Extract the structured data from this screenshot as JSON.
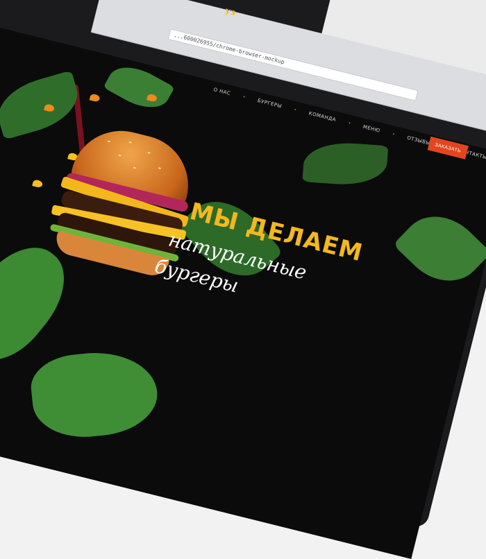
{
  "browser": {
    "url": "...600026955/chrome-browser-mockup",
    "logo_fragment": "уз"
  },
  "nav": {
    "items": [
      "О НАС",
      "БУРГЕРЫ",
      "КОМАНДА",
      "МЕНЮ",
      "ОТЗЫВЫ",
      "КОНТАКТЫ"
    ],
    "separator": "•",
    "order_button": "ЗАКАЗАТЬ"
  },
  "hero": {
    "line1": "МЫ ДЕЛАЕМ",
    "line2": "натуральные",
    "line3": "бургеры"
  },
  "colors": {
    "accent": "#e2461f",
    "headline_yellow": "#f4b81d",
    "background": "#0b0b0b"
  }
}
